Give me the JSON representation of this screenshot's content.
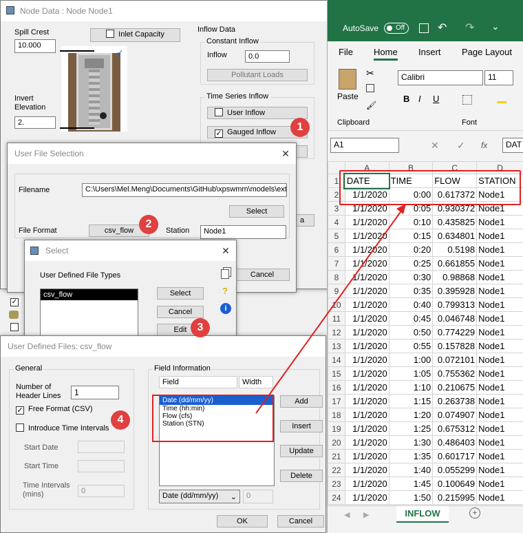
{
  "node_window": {
    "title": "Node Data : Node Node1",
    "spill_crest_label": "Spill Crest",
    "spill_crest_value": "10.000",
    "inlet_capacity_label": "Inlet Capacity",
    "invert_label_1": "Invert",
    "invert_label_2": "Elevation",
    "invert_value": "2.",
    "inflow_data_label": "Inflow Data",
    "constant_inflow_label": "Constant Inflow",
    "inflow_label": "Inflow",
    "inflow_value": "0.0",
    "pollutant_loads_label": "Pollutant Loads",
    "time_series_label": "Time Series Inflow",
    "user_inflow_label": "User Inflow",
    "gauged_inflow_label": "Gauged Inflow",
    "gauged_checked": "✓",
    "partial_button": "a"
  },
  "user_file_selection": {
    "title": "User File Selection",
    "filename_label": "Filename",
    "filename_value": "C:\\Users\\Mel.Meng\\Documents\\GitHub\\xpswmm\\models\\exte",
    "select_label": "Select",
    "file_format_label": "File Format",
    "file_format_value": "csv_flow",
    "station_label": "Station",
    "station_value": "Node1",
    "cancel_label": "Cancel"
  },
  "select_dialog": {
    "title": "Select",
    "types_label": "User Defined File Types",
    "items": [
      "csv_flow"
    ],
    "select_label": "Select",
    "cancel_label": "Cancel",
    "edit_label": "Edit",
    "qmark": "?",
    "info": "i"
  },
  "user_defined_files": {
    "title": "User Defined Files: csv_flow",
    "general_label": "General",
    "header_lines_label_1": "Number of",
    "header_lines_label_2": "Header Lines",
    "header_lines_value": "1",
    "free_format_label": "Free Format (CSV)",
    "free_format_checked": "✓",
    "intro_time_label": "Introduce Time Intervals",
    "start_date_label": "Start Date",
    "start_time_label": "Start Time",
    "time_intervals_label_1": "Time Intervals",
    "time_intervals_label_2": "(mins)",
    "time_intervals_value": "0",
    "field_info_label": "Field Information",
    "col_field": "Field",
    "col_width": "Width",
    "fields": [
      "Date (dd/mm/yy)",
      "Time (hh:min)",
      "Flow (cfs)",
      "Station (STN)"
    ],
    "add_label": "Add",
    "insert_label": "Insert",
    "update_label": "Update",
    "delete_label": "Delete",
    "field_select_value": "Date (dd/mm/yy)",
    "width_value": "0",
    "ok_label": "OK",
    "cancel_label": "Cancel"
  },
  "badges": [
    "1",
    "2",
    "3",
    "4"
  ],
  "excel": {
    "autosave_label": "AutoSave",
    "autosave_state": "Off",
    "tabs": [
      "File",
      "Home",
      "Insert",
      "Page Layout"
    ],
    "active_tab": "Home",
    "font_name": "Calibri",
    "font_size": "11",
    "paste_label": "Paste",
    "clipboard_label": "Clipboard",
    "font_label": "Font",
    "bold": "B",
    "italic": "I",
    "underline": "U",
    "name_box": "A1",
    "fx": "fx",
    "formula_partial": "DAT",
    "columns": [
      "A",
      "B",
      "C",
      "D"
    ],
    "header": [
      "DATE",
      "TIME",
      "FLOW",
      "STATION"
    ],
    "rows": [
      [
        "1/1/2020",
        "0:00",
        "0.617372",
        "Node1"
      ],
      [
        "1/1/2020",
        "0:05",
        "0.930372",
        "Node1"
      ],
      [
        "1/1/2020",
        "0:10",
        "0.435825",
        "Node1"
      ],
      [
        "1/1/2020",
        "0:15",
        "0.634801",
        "Node1"
      ],
      [
        "1/1/2020",
        "0:20",
        "0.5198",
        "Node1"
      ],
      [
        "1/1/2020",
        "0:25",
        "0.661855",
        "Node1"
      ],
      [
        "1/1/2020",
        "0:30",
        "0.98868",
        "Node1"
      ],
      [
        "1/1/2020",
        "0:35",
        "0.395928",
        "Node1"
      ],
      [
        "1/1/2020",
        "0:40",
        "0.799313",
        "Node1"
      ],
      [
        "1/1/2020",
        "0:45",
        "0.046748",
        "Node1"
      ],
      [
        "1/1/2020",
        "0:50",
        "0.774229",
        "Node1"
      ],
      [
        "1/1/2020",
        "0:55",
        "0.157828",
        "Node1"
      ],
      [
        "1/1/2020",
        "1:00",
        "0.072101",
        "Node1"
      ],
      [
        "1/1/2020",
        "1:05",
        "0.755362",
        "Node1"
      ],
      [
        "1/1/2020",
        "1:10",
        "0.210675",
        "Node1"
      ],
      [
        "1/1/2020",
        "1:15",
        "0.263738",
        "Node1"
      ],
      [
        "1/1/2020",
        "1:20",
        "0.074907",
        "Node1"
      ],
      [
        "1/1/2020",
        "1:25",
        "0.675312",
        "Node1"
      ],
      [
        "1/1/2020",
        "1:30",
        "0.486403",
        "Node1"
      ],
      [
        "1/1/2020",
        "1:35",
        "0.601717",
        "Node1"
      ],
      [
        "1/1/2020",
        "1:40",
        "0.055299",
        "Node1"
      ],
      [
        "1/1/2020",
        "1:45",
        "0.100649",
        "Node1"
      ],
      [
        "1/1/2020",
        "1:50",
        "0.215995",
        "Node1"
      ]
    ],
    "sheet_tab": "INFLOW",
    "add_sheet": "+"
  },
  "colors": {
    "excel_green": "#217346",
    "annotation_red": "#e02020",
    "badge_red": "#e04040"
  }
}
